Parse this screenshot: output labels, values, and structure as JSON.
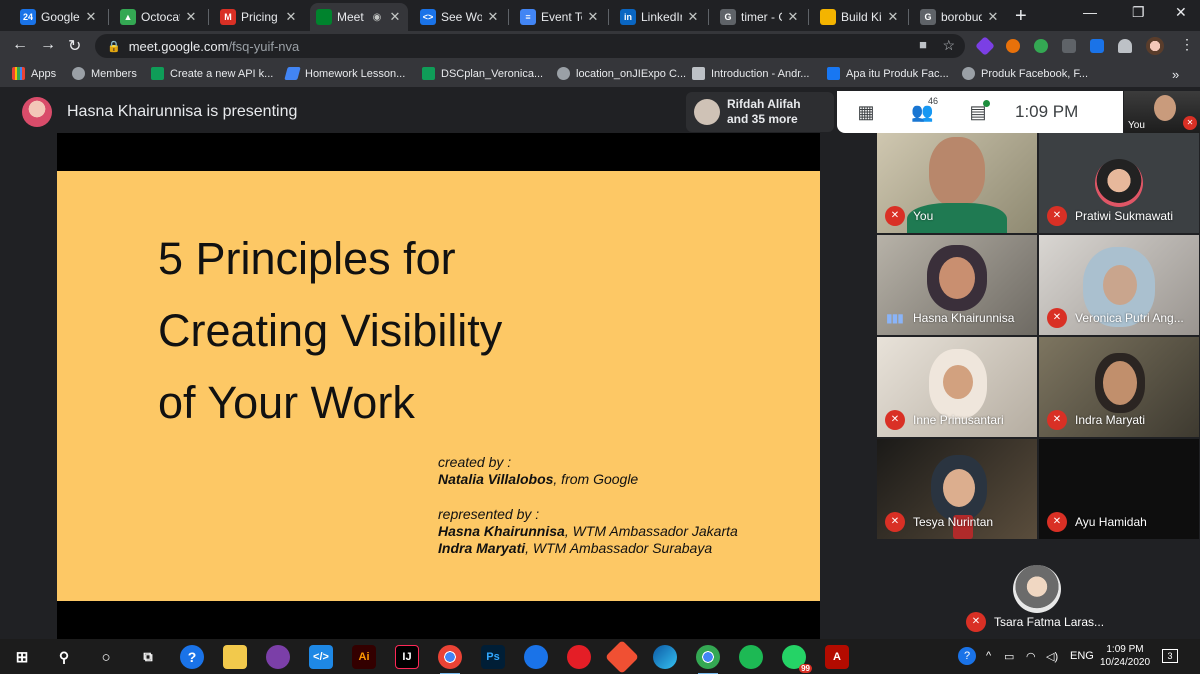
{
  "browser": {
    "tabs": [
      {
        "label": "Google C",
        "favicon_text": "24",
        "favicon_color": "#1a73e8",
        "active": false
      },
      {
        "label": "Octocat",
        "favicon_text": "▲",
        "favicon_color": "#34a853",
        "active": false
      },
      {
        "label": "Pricing | ",
        "favicon_text": "M",
        "favicon_color": "#d93025",
        "active": false
      },
      {
        "label": "Meet",
        "favicon_text": "",
        "favicon_color": "#00832d",
        "active": true
      },
      {
        "label": "See Wom",
        "favicon_text": "<>",
        "favicon_color": "#1a73e8",
        "active": false
      },
      {
        "label": "Event Ter",
        "favicon_text": "≡",
        "favicon_color": "#4285f4",
        "active": false
      },
      {
        "label": "LinkedIn",
        "favicon_text": "in",
        "favicon_color": "#0a66c2",
        "active": false
      },
      {
        "label": "timer - G",
        "favicon_text": "G",
        "favicon_color": "#5f6368",
        "active": false
      },
      {
        "label": "Build Kill",
        "favicon_text": "",
        "favicon_color": "#f4b400",
        "active": false
      },
      {
        "label": "borobud",
        "favicon_text": "G",
        "favicon_color": "#5f6368",
        "active": false
      }
    ],
    "new_tab_glyph": "+",
    "window_controls": {
      "minimize": "—",
      "restore": "❐",
      "close": "✕"
    },
    "nav": {
      "back": "←",
      "forward": "→",
      "reload": "↻"
    },
    "url_host": "meet.google.com",
    "url_path": "/fsq-yuif-nva",
    "bookmarks": [
      {
        "label": "Apps",
        "icon_color": "#ea4335"
      },
      {
        "label": "Members",
        "icon_color": "#9aa0a6"
      },
      {
        "label": "Create a new API k...",
        "icon_color": "#0f9d58"
      },
      {
        "label": "Homework Lesson...",
        "icon_color": "#4285f4"
      },
      {
        "label": "DSCplan_Veronica...",
        "icon_color": "#0f9d58"
      },
      {
        "label": "location_onJIExpo C...",
        "icon_color": "#9aa0a6"
      },
      {
        "label": "Introduction - Andr...",
        "icon_color": "#bdc1c6"
      },
      {
        "label": "Apa itu Produk Fac...",
        "icon_color": "#1877f2"
      },
      {
        "label": "Produk Facebook, F...",
        "icon_color": "#9aa0a6"
      }
    ],
    "more_bookmarks": "»"
  },
  "meet": {
    "presenting_label": "Hasna Khairunnisa is presenting",
    "others_name": "Rifdah Alifah",
    "others_more": "and 35 more",
    "participant_count": "46",
    "clock": "1:09 PM",
    "self_label": "You",
    "slide": {
      "title_line1": "5 Principles for",
      "title_line2": "Creating Visibility",
      "title_line3": "of Your Work",
      "created_by_label": "created by :",
      "creator_name": "Natalia Villalobos",
      "creator_org": ", from Google",
      "represented_by_label": "represented by :",
      "presenter1_name": "Hasna Khairunnisa",
      "presenter1_role": ", WTM Ambassador Jakarta",
      "presenter2_name": "Indra Maryati",
      "presenter2_role": ", WTM Ambassador Surabaya"
    },
    "participants": [
      {
        "name": "You",
        "muted": true
      },
      {
        "name": "Pratiwi Sukmawati",
        "muted": true
      },
      {
        "name": "Hasna Khairunnisa",
        "muted": false
      },
      {
        "name": "Veronica Putri Ang...",
        "muted": true
      },
      {
        "name": "Inne Prinusantari",
        "muted": true
      },
      {
        "name": "Indra Maryati",
        "muted": true
      },
      {
        "name": "Tesya Nurintan",
        "muted": true
      },
      {
        "name": "Ayu Hamidah",
        "muted": true
      }
    ],
    "last_participant": "Tsara Fatma Laras..."
  },
  "taskbar": {
    "time": "1:09 PM",
    "date": "10/24/2020",
    "language": "ENG",
    "notifications": "3",
    "whatsapp_badge": "99"
  }
}
